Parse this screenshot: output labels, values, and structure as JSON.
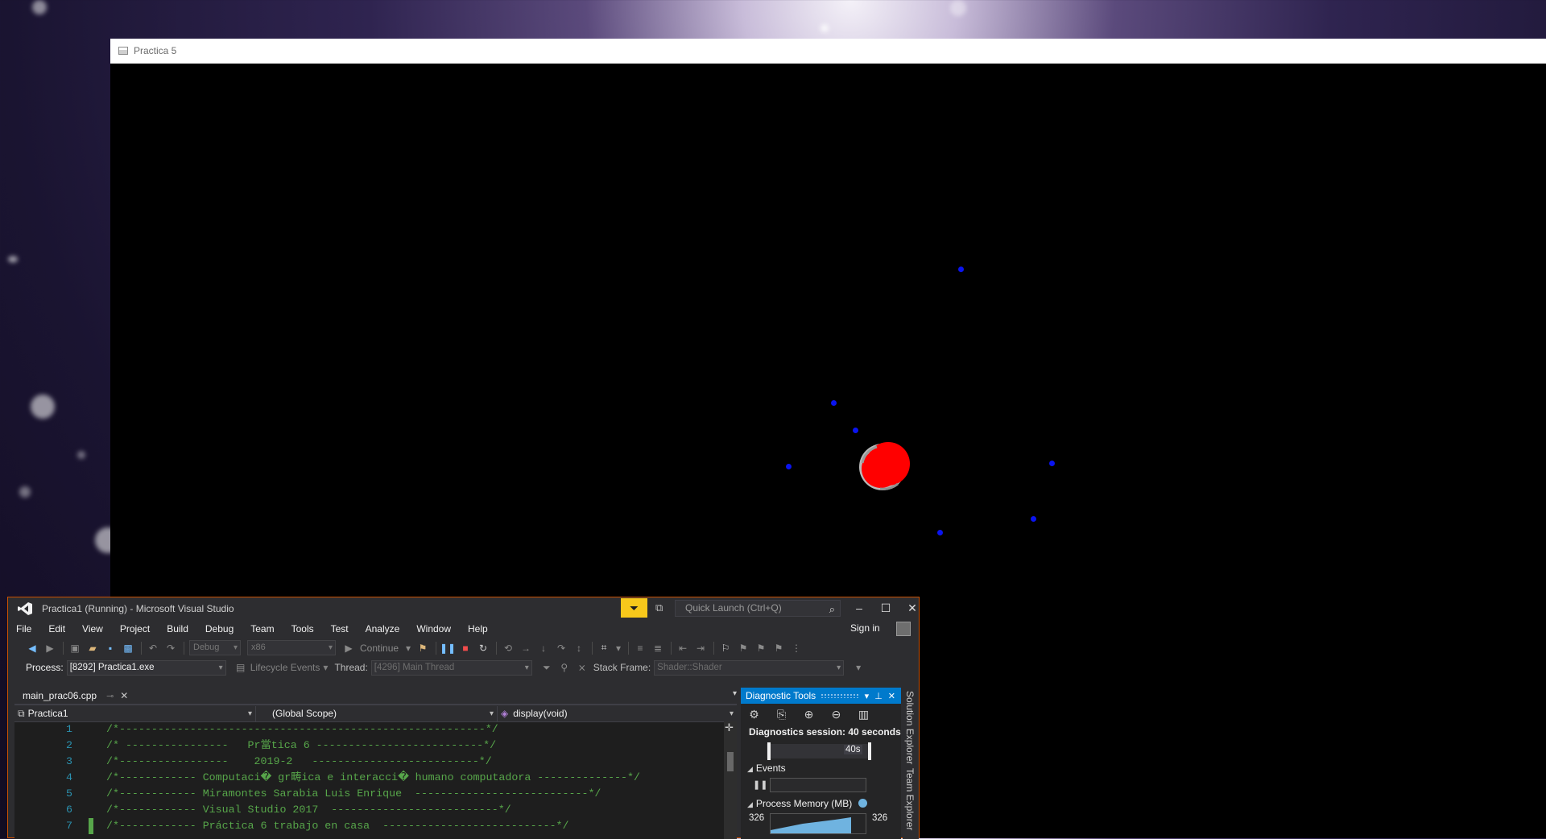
{
  "gl_window": {
    "title": "Practica 5"
  },
  "vs": {
    "title": "Practica1 (Running) - Microsoft Visual Studio",
    "quick_launch_placeholder": "Quick Launch (Ctrl+Q)",
    "menu": [
      "File",
      "Edit",
      "View",
      "Project",
      "Build",
      "Debug",
      "Team",
      "Tools",
      "Test",
      "Analyze",
      "Window",
      "Help"
    ],
    "sign_in": "Sign in",
    "toolbar": {
      "config": "Debug",
      "platform": "x86",
      "continue": "Continue"
    },
    "debugbar": {
      "process_label": "Process:",
      "process_value": "[8292] Practica1.exe",
      "lifecycle": "Lifecycle Events",
      "thread_label": "Thread:",
      "thread_value": "[4296] Main Thread",
      "stack_label": "Stack Frame:",
      "stack_value": "Shader::Shader"
    },
    "editor": {
      "tab_name": "main_prac06.cpp",
      "project_scope": "Practica1",
      "global_scope": "(Global Scope)",
      "function_scope": "display(void)",
      "lines": [
        {
          "num": "1",
          "text": "/*---------------------------------------------------------*/",
          "changed": false
        },
        {
          "num": "2",
          "text": "/* ----------------   Pr當tica 6 --------------------------*/",
          "changed": false
        },
        {
          "num": "3",
          "text": "/*-----------------    2019-2   --------------------------*/",
          "changed": false
        },
        {
          "num": "4",
          "text": "/*------------ Computaci� gr畴ica e interacci� humano computadora --------------*/",
          "changed": false
        },
        {
          "num": "5",
          "text": "/*------------ Miramontes Sarabia Luis Enrique  ---------------------------*/",
          "changed": false
        },
        {
          "num": "6",
          "text": "/*------------ Visual Studio 2017  --------------------------*/",
          "changed": false
        },
        {
          "num": "7",
          "text": "/*------------ Práctica 6 trabajo en casa  ---------------------------*/",
          "changed": true
        }
      ]
    },
    "diagnostics": {
      "title": "Diagnostic Tools",
      "session": "Diagnostics session: 40 seconds",
      "timeline_label": "40s",
      "events": "Events",
      "process_memory": "Process Memory (MB)",
      "mem_min": "326",
      "mem_max": "326"
    },
    "side_tabs": [
      "Solution Explorer",
      "Team Explorer"
    ]
  }
}
